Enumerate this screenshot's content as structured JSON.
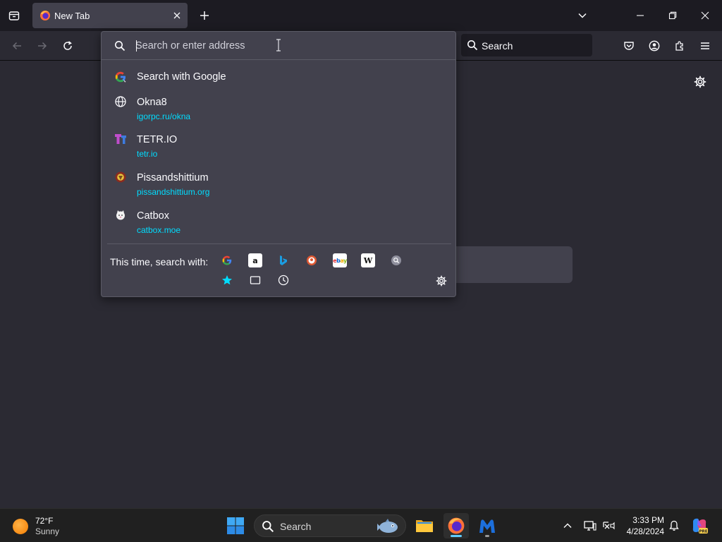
{
  "window": {
    "tab": {
      "title": "New Tab"
    }
  },
  "navbar": {
    "search_placeholder": "Search"
  },
  "urlbar": {
    "placeholder": "Search or enter address",
    "results": [
      {
        "title": "Search with Google",
        "url": "",
        "icon": "google-icon"
      },
      {
        "title": "Okna8",
        "url": "igorpc.ru/okna",
        "icon": "globe-icon"
      },
      {
        "title": "TETR.IO",
        "url": "tetr.io",
        "icon": "tetrio-icon"
      },
      {
        "title": "Pissandshittium",
        "url": "pissandshittium.org",
        "icon": "pissandshittium-icon"
      },
      {
        "title": "Catbox",
        "url": "catbox.moe",
        "icon": "catbox-icon"
      }
    ],
    "oneoff_label": "This time, search with:",
    "engines": [
      "google",
      "amazon",
      "bing",
      "duckduckgo",
      "ebay",
      "wikipedia",
      "other-search"
    ],
    "modes": [
      "bookmarks",
      "tabs",
      "history"
    ]
  },
  "taskbar": {
    "weather": {
      "temp": "72°F",
      "condition": "Sunny"
    },
    "search_placeholder": "Search",
    "clock": {
      "time": "3:33 PM",
      "date": "4/28/2024"
    }
  },
  "colors": {
    "accent_url": "#00ddff",
    "toolbar": "#2b2a33",
    "popup": "#42414d"
  }
}
